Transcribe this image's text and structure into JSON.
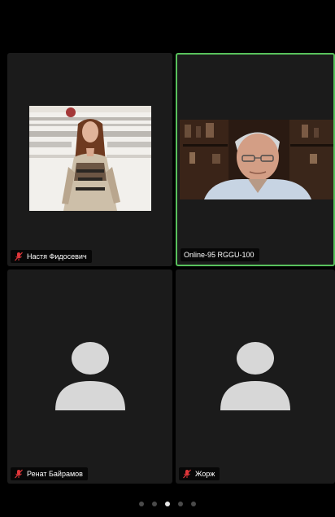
{
  "participants": [
    {
      "name": "Настя Фидосевич",
      "muted": true,
      "video": true,
      "active_speaker": false
    },
    {
      "name": "Online-95 RGGU-100",
      "muted": false,
      "video": true,
      "active_speaker": true
    },
    {
      "name": "Ренат Байрамов",
      "muted": true,
      "video": false,
      "active_speaker": false
    },
    {
      "name": "Жорж",
      "muted": true,
      "video": false,
      "active_speaker": false
    }
  ],
  "pager": {
    "pages": 5,
    "current": 3
  },
  "colors": {
    "active_border": "#58c15c",
    "muted_icon": "#e0363a",
    "avatar": "#d7d7d7",
    "tile_bg": "#1b1b1b"
  }
}
